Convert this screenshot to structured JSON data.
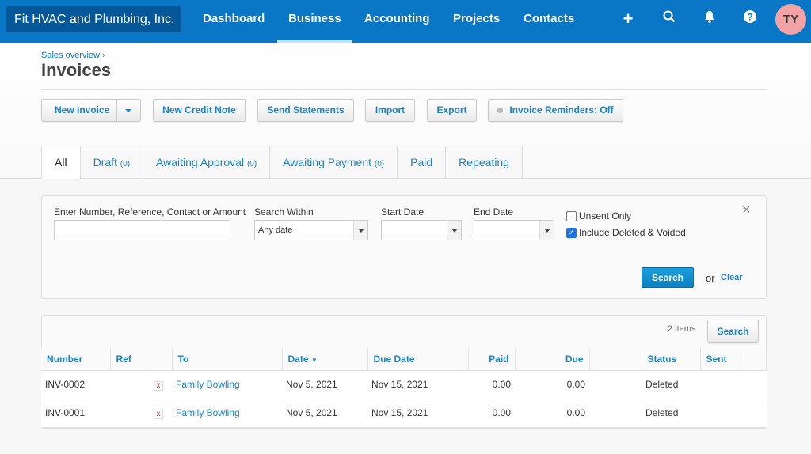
{
  "nav": {
    "org": "Fit HVAC and Plumbing, Inc.",
    "items": [
      "Dashboard",
      "Business",
      "Accounting",
      "Projects",
      "Contacts"
    ],
    "active": "Business",
    "avatar": "TY"
  },
  "page": {
    "breadcrumb": "Sales overview",
    "breadcrumb_sep": "›",
    "title": "Invoices"
  },
  "toolbar": {
    "new_invoice": "New Invoice",
    "new_credit_note": "New Credit Note",
    "send_statements": "Send Statements",
    "import": "Import",
    "export": "Export",
    "reminders": "Invoice Reminders: Off"
  },
  "tabs": [
    {
      "label": "All",
      "count": ""
    },
    {
      "label": "Draft",
      "count": "(0)"
    },
    {
      "label": "Awaiting Approval",
      "count": "(0)"
    },
    {
      "label": "Awaiting Payment",
      "count": "(0)"
    },
    {
      "label": "Paid",
      "count": ""
    },
    {
      "label": "Repeating",
      "count": ""
    }
  ],
  "filter": {
    "search_label": "Enter Number, Reference, Contact or Amount",
    "search_value": "",
    "within_label": "Search Within",
    "within_value": "Any date",
    "start_label": "Start Date",
    "end_label": "End Date",
    "unsent_label": "Unsent Only",
    "unsent_checked": false,
    "deleted_label": "Include Deleted & Voided",
    "deleted_checked": true,
    "search_btn": "Search",
    "or": "or",
    "clear": "Clear",
    "close": "×"
  },
  "results": {
    "count": "2 items",
    "search_btn": "Search",
    "columns": [
      "Number",
      "Ref",
      "",
      "To",
      "Date",
      "Due Date",
      "Paid",
      "Due",
      "",
      "Status",
      "Sent",
      ""
    ],
    "rows": [
      {
        "number": "INV-0002",
        "ref": "",
        "to": "Family Bowling",
        "date": "Nov 5, 2021",
        "due_date": "Nov 15, 2021",
        "paid": "0.00",
        "due": "0.00",
        "status": "Deleted",
        "sent": ""
      },
      {
        "number": "INV-0001",
        "ref": "",
        "to": "Family Bowling",
        "date": "Nov 5, 2021",
        "due_date": "Nov 15, 2021",
        "paid": "0.00",
        "due": "0.00",
        "status": "Deleted",
        "sent": ""
      }
    ]
  }
}
